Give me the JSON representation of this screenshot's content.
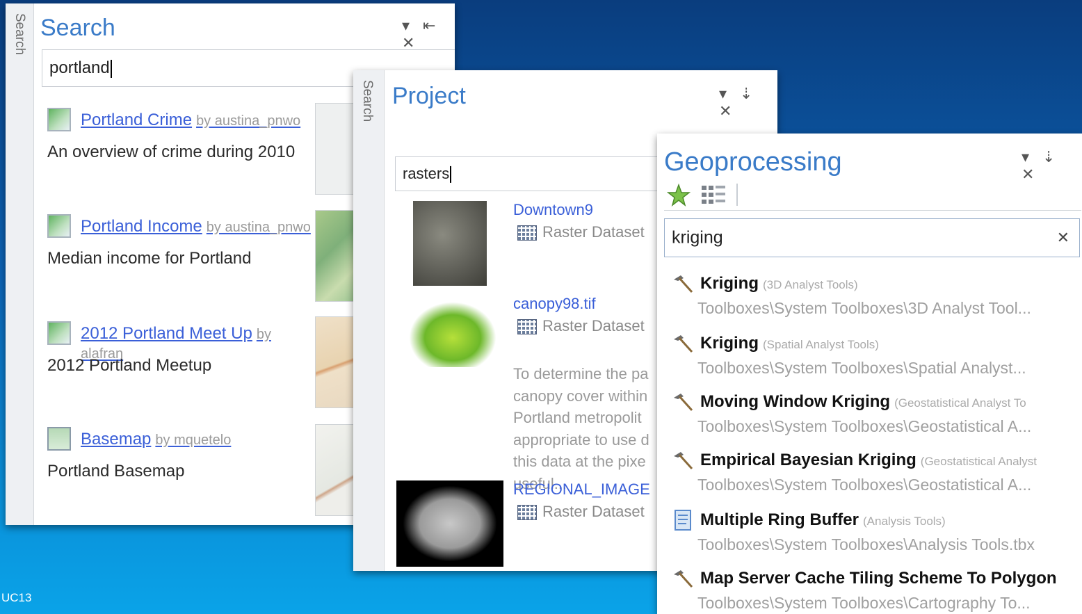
{
  "footer": {
    "label": "UC13"
  },
  "search_panel": {
    "side_tab": "Search",
    "title": "Search",
    "controls": "▾ ⇤ ✕",
    "query": "portland",
    "results": [
      {
        "title": "Portland Crime",
        "by": "by austina_pnwo",
        "description": "An overview of crime during 2010"
      },
      {
        "title": "Portland Income",
        "by": "by austina_pnwo",
        "description": "Median income for Portland"
      },
      {
        "title": "2012 Portland Meet Up",
        "by": "by alafran",
        "description": "2012 Portland Meetup"
      },
      {
        "title": "Basemap",
        "by": "by mquetelo",
        "description": "Portland Basemap"
      }
    ]
  },
  "project_panel": {
    "side_tab": "Search",
    "title": "Project",
    "controls": "▾ ⇣ ✕",
    "query": "rasters",
    "items": [
      {
        "name": "Downtown9",
        "type": "Raster Dataset"
      },
      {
        "name": "canopy98.tif",
        "type": "Raster Dataset",
        "description_lines": [
          "To determine the pa",
          "canopy cover within",
          "Portland metropolit",
          "appropriate to use d",
          "this data at the pixe",
          "useful..."
        ]
      },
      {
        "name": "REGIONAL_IMAGE",
        "type": "Raster Dataset"
      }
    ]
  },
  "geo_panel": {
    "title": "Geoprocessing",
    "controls": "▾ ⇣ ✕",
    "query": "kriging",
    "clear_glyph": "✕",
    "tools": [
      {
        "name": "Kriging",
        "toolbox": "(3D Analyst Tools)",
        "path": "Toolboxes\\System Toolboxes\\3D Analyst Tool...",
        "icon": "hammer-icon"
      },
      {
        "name": "Kriging",
        "toolbox": "(Spatial Analyst Tools)",
        "path": "Toolboxes\\System Toolboxes\\Spatial Analyst...",
        "icon": "hammer-icon"
      },
      {
        "name": "Moving Window Kriging",
        "toolbox": "(Geostatistical Analyst To",
        "path": "Toolboxes\\System Toolboxes\\Geostatistical A...",
        "icon": "hammer-icon"
      },
      {
        "name": "Empirical Bayesian Kriging",
        "toolbox": "(Geostatistical Analyst",
        "path": "Toolboxes\\System Toolboxes\\Geostatistical A...",
        "icon": "hammer-icon"
      },
      {
        "name": "Multiple Ring Buffer",
        "toolbox": "(Analysis Tools)",
        "path": "Toolboxes\\System Toolboxes\\Analysis Tools.tbx",
        "icon": "script-icon"
      },
      {
        "name": "Map Server Cache Tiling Scheme To Polygon",
        "toolbox": "",
        "path": "Toolboxes\\System Toolboxes\\Cartography To...",
        "icon": "hammer-icon"
      }
    ]
  },
  "colors": {
    "accent": "#3a7bc8",
    "link": "#3a5fd8",
    "background_top": "#0a3d7e",
    "background_bottom": "#0aa3e8"
  }
}
